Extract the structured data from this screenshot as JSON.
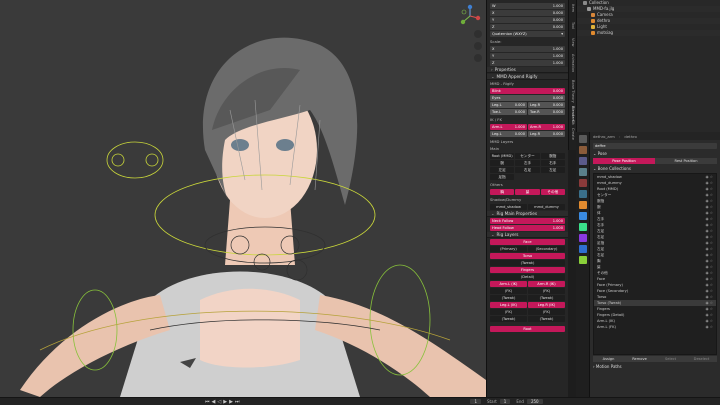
{
  "npanel": {
    "top_rows": [
      {
        "label": "W",
        "value": "1.000"
      },
      {
        "label": "X",
        "value": "0.000"
      },
      {
        "label": "Y",
        "value": "0.000"
      },
      {
        "label": "Z",
        "value": "0.000"
      }
    ],
    "rotation_mode": "Quaternion (WXYZ)",
    "scale_label": "Scale:",
    "scale_rows": [
      {
        "label": "X",
        "value": "1.000"
      },
      {
        "label": "Y",
        "value": "1.000"
      },
      {
        "label": "Z",
        "value": "1.000"
      }
    ],
    "properties_header": "Properties",
    "mmd_header": "MMD Append Rigify",
    "mmd_rigify_label": "MMD - Rigify",
    "mmd_fields": [
      {
        "label": "Blink",
        "value": "0.000",
        "pink": true
      },
      {
        "label": "Eyes",
        "value": "0.000",
        "pink": false
      },
      {
        "label": "Leg.L",
        "value": "0.000",
        "pink": false
      },
      {
        "label": "Leg.R",
        "value": "0.000",
        "pink": false
      },
      {
        "label": "Toe.L",
        "value": "0.000",
        "pink": false
      },
      {
        "label": "Toe.R",
        "value": "0.000",
        "pink": false
      }
    ],
    "ik_fk_label": "IK / FK",
    "ikfk_fields": [
      {
        "label": "Arm.L",
        "value": "1.000",
        "pink": true
      },
      {
        "label": "Arm.R",
        "value": "1.000",
        "pink": true
      },
      {
        "label": "Leg.L",
        "value": "0.000",
        "pink": false
      },
      {
        "label": "Leg.R",
        "value": "0.000",
        "pink": false
      }
    ],
    "mmd_layers_label": "MMD Layers",
    "main_label": "Main",
    "layer_rows": [
      [
        "Root (MMD)",
        "センター",
        "腕指"
      ],
      [
        "腕",
        "左手",
        "右手"
      ],
      [
        "左足",
        "右足",
        "左足"
      ],
      [
        "足指",
        "",
        ""
      ]
    ],
    "others_label": "Others",
    "others_row": [
      "胸",
      "髪",
      "その他"
    ],
    "shadow_label": "Shadow/Dummy",
    "shadow_row": [
      "mmd_shadow",
      "mmd_dummy"
    ],
    "rig_main_header": "Rig Main Properties",
    "rig_main_fields": [
      {
        "label": "Neck Follow",
        "value": "1.000"
      },
      {
        "label": "Head Follow",
        "value": "1.000"
      }
    ],
    "rig_layers_header": "Rig Layers",
    "rig_layers": {
      "face": "Face",
      "face_primary": "(Primary)",
      "face_secondary": "(Secondary)",
      "torso": "Torso",
      "torso_tweak": "(Tweak)",
      "fingers": "Fingers",
      "fingers_detail": "(Detail)",
      "arm_l_ik": "Arm.L (IK)",
      "arm_r_ik": "Arm.R (IK)",
      "arm_l_fk": "(FK)",
      "arm_r_fk": "(FK)",
      "arm_l_tweak": "(Tweak)",
      "arm_r_tweak": "(Tweak)",
      "leg_l_ik": "Leg.L (IK)",
      "leg_r_ik": "Leg.R (IK)",
      "leg_l_fk": "(FK)",
      "leg_r_fk": "(FK)",
      "leg_l_tweak": "(Tweak)",
      "leg_r_tweak": "(Tweak)",
      "root": "Root"
    }
  },
  "vtabs": [
    "Item",
    "Tool",
    "View",
    "Animation",
    "Bone Theory",
    "BlenderKit",
    "Create"
  ],
  "outliner": {
    "items": [
      {
        "label": "Collection",
        "color": "#8a8a8a"
      },
      {
        "label": "MMD-fa.jlg",
        "color": "#9b9b9b"
      },
      {
        "label": "Camera",
        "color": "#d7863a"
      },
      {
        "label": "dethro",
        "color": "#e08a2f"
      },
      {
        "label": "Light",
        "color": "#e0b23a"
      },
      {
        "label": "motsiag",
        "color": "#e08a2f"
      }
    ]
  },
  "properties": {
    "object_name": "dethro_arm",
    "armature_name": "dethro",
    "search_value": "deffre",
    "pose_header": "Pose",
    "pose_position": "Pose Position",
    "rest_position": "Rest Position",
    "bone_collections_header": "Bone Collections",
    "bone_collections": [
      "mmd_shadow",
      "mmd_dummy",
      "Root (MMD)",
      "センター",
      "腕指",
      "腕",
      "体",
      "左手",
      "右手",
      "左足",
      "右足",
      "足指",
      "左足",
      "右足",
      "胸",
      "髪",
      "その他",
      "Face",
      "Face (Primary)",
      "Face (Secondary)",
      "Torso",
      "Torso (Tweak)",
      "Fingers",
      "Fingers (Detail)",
      "Arm.L (IK)",
      "Arm.L (FK)"
    ],
    "assign": "Assign",
    "remove": "Remove",
    "select": "Select",
    "deselect": "Deselect",
    "motion_paths_header": "Motion Paths"
  },
  "timeline": {
    "frame": "1",
    "start_label": "Start",
    "start_value": "1",
    "end_label": "End",
    "end_value": "250"
  },
  "colors": {
    "accent": "#c4185a",
    "panel": "#262626",
    "viewport": "#3a3a3a"
  }
}
